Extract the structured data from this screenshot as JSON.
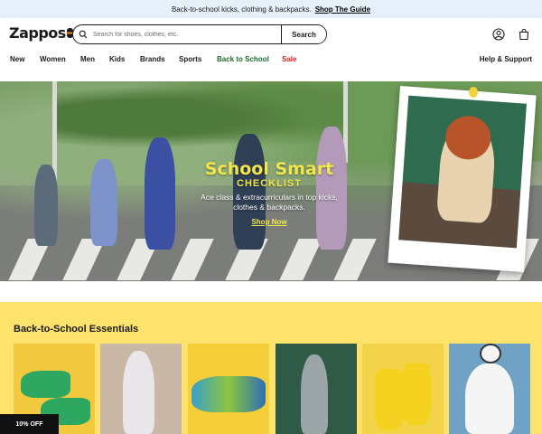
{
  "promo": {
    "text": "Back-to-school kicks, clothing & backpacks.",
    "link": "Shop The Guide"
  },
  "header": {
    "logo": "Zappos",
    "search_placeholder": "Search for shoes, clothes, etc.",
    "search_button": "Search",
    "icons": [
      "account-icon",
      "cart-icon"
    ]
  },
  "nav": {
    "items": [
      "New",
      "Women",
      "Men",
      "Kids",
      "Brands",
      "Sports",
      "Back to School",
      "Sale"
    ],
    "help": "Help & Support"
  },
  "hero": {
    "title": "School Smart",
    "subtitle": "CHECKLIST",
    "description_line1": "Ace class & extracurriculars in top kicks,",
    "description_line2": "clothes & backpacks.",
    "cta": "Shop Now"
  },
  "essentials": {
    "title": "Back-to-School Essentials"
  },
  "offer_badge": "10% OFF",
  "colors": {
    "promo_bg": "#e6f0fb",
    "back_to_school": "#1f6d2c",
    "sale": "#e0211e",
    "hero_title": "#f2e74a",
    "essentials_bg": "#fde36b"
  }
}
